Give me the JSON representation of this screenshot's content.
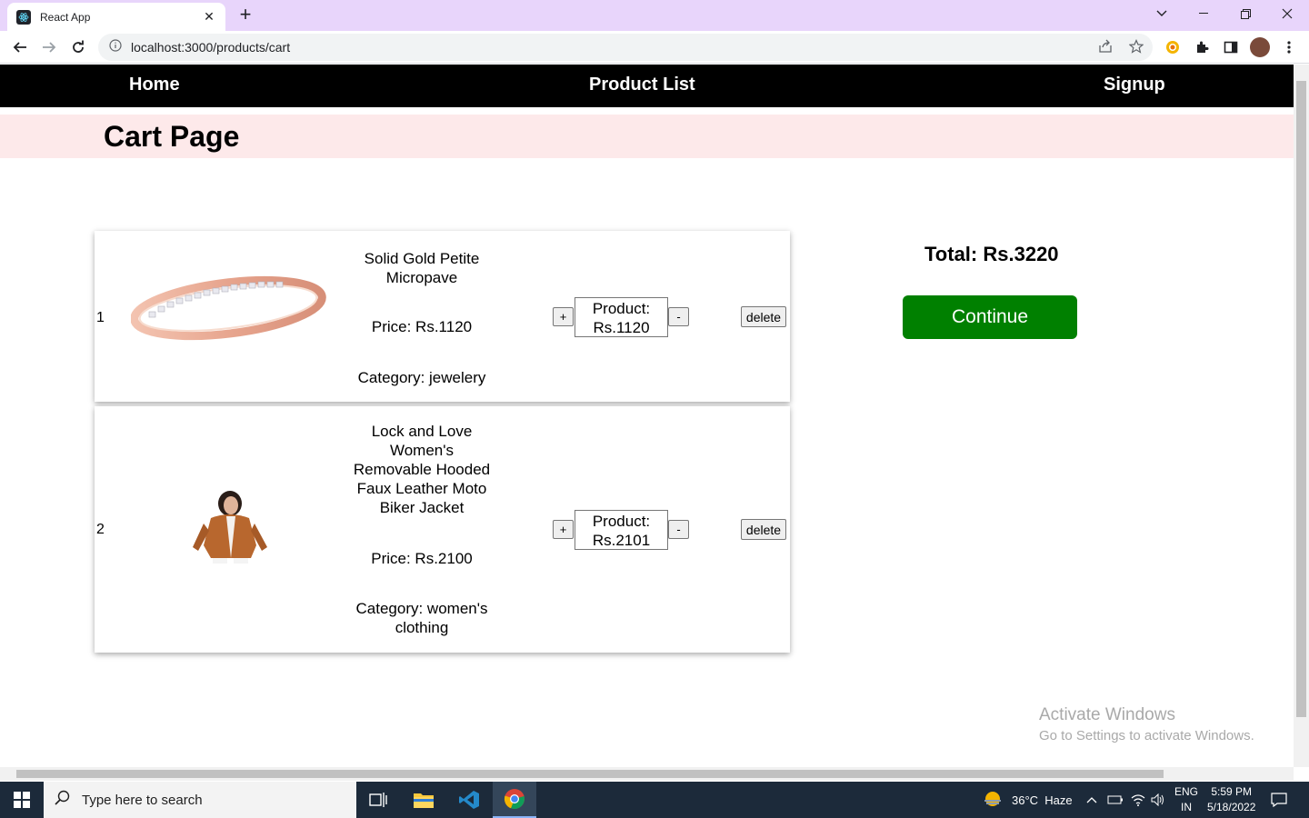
{
  "browser": {
    "tab_title": "React App",
    "url": "localhost:3000/products/cart"
  },
  "nav": {
    "home": "Home",
    "product_list": "Product List",
    "signup": "Signup"
  },
  "page": {
    "title": "Cart Page"
  },
  "cart": {
    "items": [
      {
        "index": "1",
        "name": "Solid Gold Petite Micropave",
        "price": "Price: Rs.1120",
        "category": "Category: jewelery",
        "plus": "+",
        "minus": "-",
        "product_label": "Product:",
        "product_value": "Rs.1120",
        "delete": "delete"
      },
      {
        "index": "2",
        "name": "Lock and Love Women's Removable Hooded Faux Leather Moto Biker Jacket",
        "price": "Price: Rs.2100",
        "category": "Category: women's clothing",
        "plus": "+",
        "minus": "-",
        "product_label": "Product:",
        "product_value": "Rs.2101",
        "delete": "delete"
      }
    ],
    "total": "Total: Rs.3220",
    "continue": "Continue"
  },
  "watermark": {
    "line1": "Activate Windows",
    "line2": "Go to Settings to activate Windows."
  },
  "taskbar": {
    "search_placeholder": "Type here to search",
    "weather": "36°C  Haze",
    "lang1": "ENG",
    "lang2": "IN",
    "time": "5:59 PM",
    "date": "5/18/2022"
  },
  "colors": {
    "continue_bg": "#008000",
    "nav_bg": "#000000",
    "pagehead_bg": "#fde9ea",
    "tabbar_bg": "#e8d5fb"
  }
}
